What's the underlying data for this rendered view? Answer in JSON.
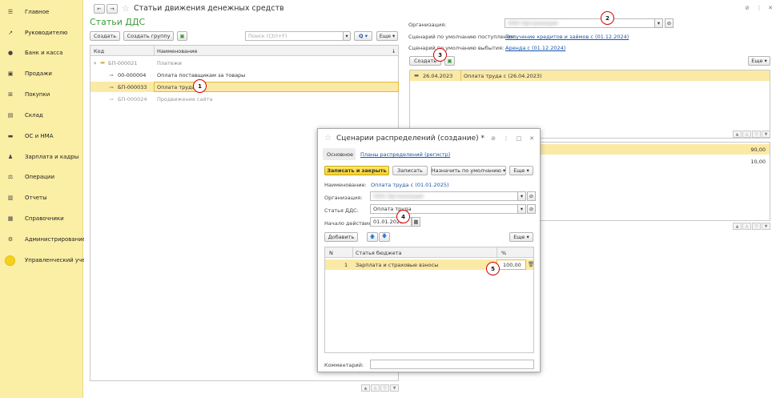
{
  "sidebar": {
    "items": [
      {
        "label": "Главное",
        "icon": "menu-icon"
      },
      {
        "label": "Руководителю",
        "icon": "trend-icon"
      },
      {
        "label": "Банк и касса",
        "icon": "coin-icon"
      },
      {
        "label": "Продажи",
        "icon": "bag-icon"
      },
      {
        "label": "Покупки",
        "icon": "cart-icon"
      },
      {
        "label": "Склад",
        "icon": "warehouse-icon"
      },
      {
        "label": "ОС и НМА",
        "icon": "truck-icon"
      },
      {
        "label": "Зарплата и кадры",
        "icon": "people-icon"
      },
      {
        "label": "Операции",
        "icon": "scale-icon"
      },
      {
        "label": "Отчеты",
        "icon": "chart-icon"
      },
      {
        "label": "Справочники",
        "icon": "book-icon"
      },
      {
        "label": "Администрирование",
        "icon": "gear-icon"
      },
      {
        "label": "Управленческий учет",
        "icon": "circle-icon"
      }
    ]
  },
  "window": {
    "title": "Статьи движения денежных средств",
    "back": "←",
    "forward": "→",
    "star": "☆"
  },
  "list": {
    "heading": "Статьи ДДС",
    "create_label": "Создать",
    "create_group_label": "Создать группу",
    "search_placeholder": "Поиск (Ctrl+F)",
    "search_btn": "Q",
    "more_label": "Еще",
    "col_code": "Код",
    "col_name": "Наименование",
    "rows": [
      {
        "code": "БП-000021",
        "name": "Платежи"
      },
      {
        "code": "00-000004",
        "name": "Оплата поставщикам за товары"
      },
      {
        "code": "БП-000033",
        "name": "Оплата труда"
      },
      {
        "code": "БП-000024",
        "name": "Продвижение сайта"
      }
    ]
  },
  "right": {
    "org_label": "Организация:",
    "org_value": "ООО Организация",
    "income_label": "Сценарий по умолчанию поступления:",
    "income_value": "Получение кредитов и займов с (01.12.2024)",
    "expense_label": "Сценарий по умолчанию выбытия:",
    "expense_value": "Аренда с (01.12.2024)",
    "create_label": "Создать",
    "more_label": "Еще",
    "rows": [
      {
        "date": "26.04.2023",
        "name": "Оплата труда с (26.04.2023)"
      }
    ],
    "values": [
      "90,00",
      "10,00"
    ]
  },
  "dialog": {
    "title": "Сценарии распределений (создание) *",
    "tab_main": "Основное",
    "tab_plans": "Планы распределений (регистр)",
    "save_close": "Записать и закрыть",
    "save": "Записать",
    "set_default": "Назначить по умолчанию",
    "more": "Еще",
    "name_label": "Наименование:",
    "name_value": "Оплата труда с (01.01.2025)",
    "org_label": "Организация:",
    "org_value": "ООО Организация",
    "article_label": "Статья ДДС:",
    "article_value": "Оплата труда",
    "start_label": "Начало действия:",
    "start_value": "01.01.2025",
    "add_label": "Добавить",
    "more2": "Еще",
    "col_n": "N",
    "col_article": "Статья бюджета",
    "col_pct": "%",
    "rows": [
      {
        "n": "1",
        "article": "Зарплата и страховые взносы",
        "pct": "100,00"
      }
    ],
    "comment_label": "Комментарий:"
  },
  "markers": [
    "1",
    "2",
    "3",
    "4",
    "5"
  ]
}
